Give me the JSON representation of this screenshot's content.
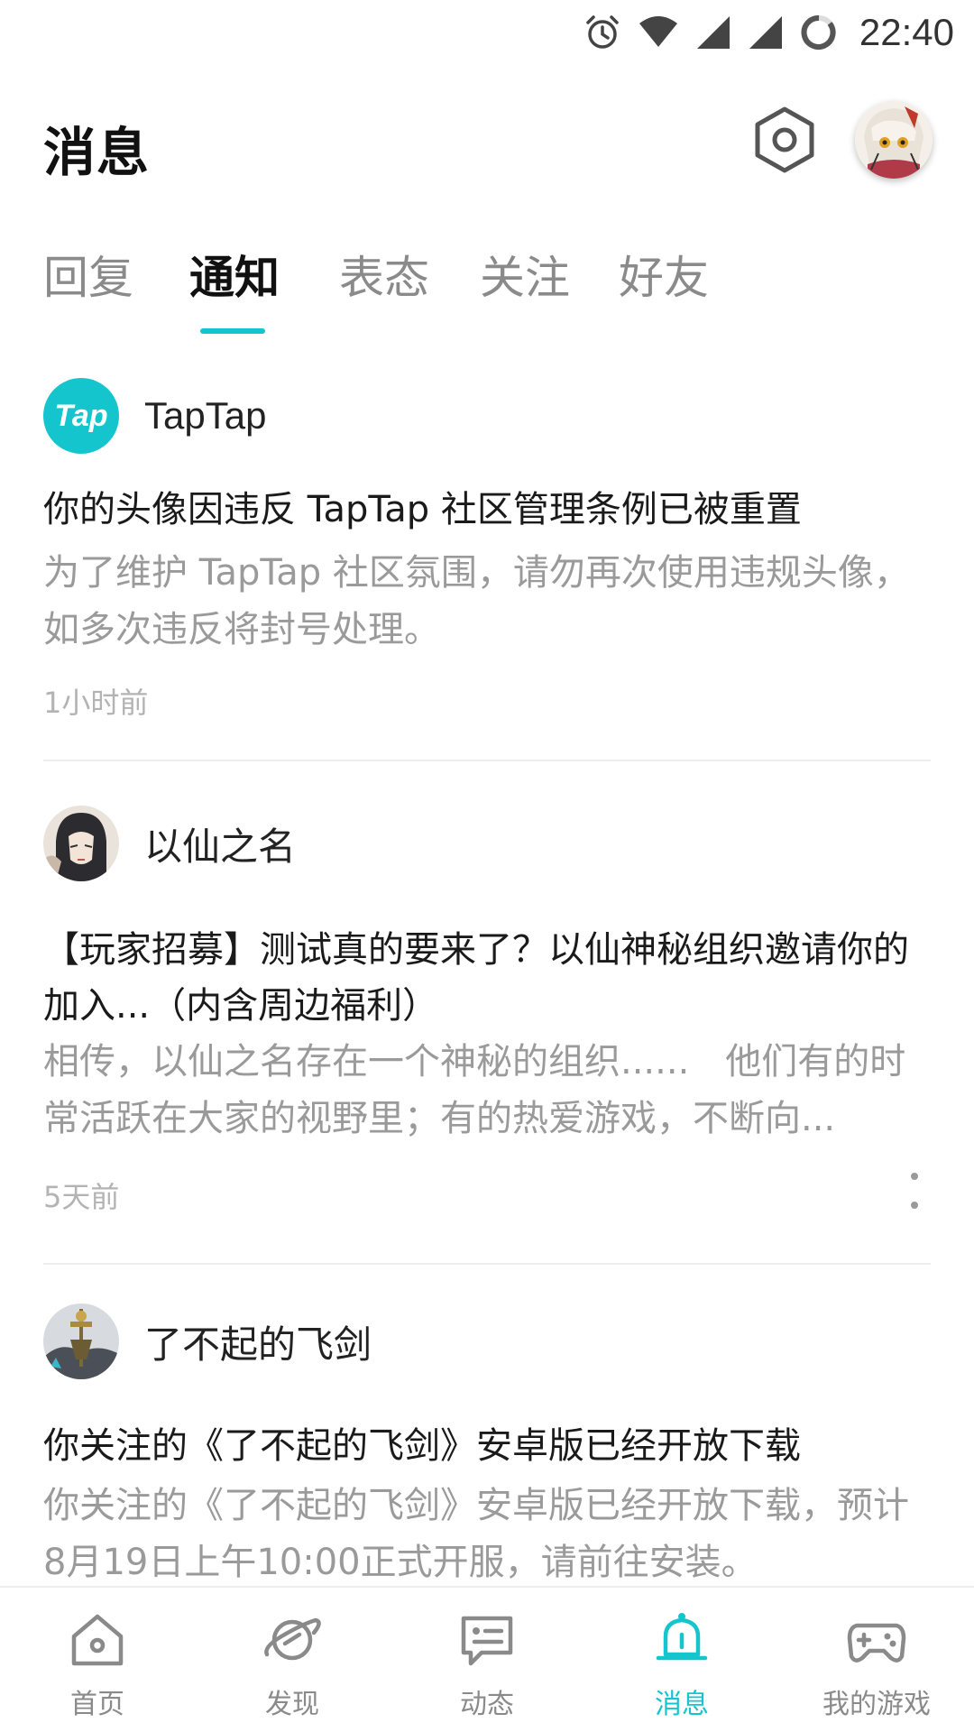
{
  "status_bar": {
    "time": "22:40"
  },
  "header": {
    "title": "消息"
  },
  "tabs": [
    {
      "label": "回复",
      "active": false
    },
    {
      "label": "通知",
      "active": true
    },
    {
      "label": "表态",
      "active": false
    },
    {
      "label": "关注",
      "active": false
    },
    {
      "label": "好友",
      "active": false
    }
  ],
  "notifications": [
    {
      "sender": "TapTap",
      "logo_text": "Tap",
      "title": "你的头像因违反 TapTap 社区管理条例已被重置",
      "body": "为了维护 TapTap 社区氛围，请勿再次使用违规头像，如多次违反将封号处理。",
      "time": "1小时前"
    },
    {
      "sender": "以仙之名",
      "title": "【玩家招募】测试真的要来了？以仙神秘组织邀请你的加入...（内含周边福利）",
      "body": "相传，以仙之名存在一个神秘的组织......　他们有的时常活跃在大家的视野里；有的热爱游戏，不断向...",
      "time": "5天前"
    },
    {
      "sender": "了不起的飞剑",
      "title": "你关注的《了不起的飞剑》安卓版已经开放下载",
      "body": "你关注的《了不起的飞剑》安卓版已经开放下载，预计8月19日上午10:00正式开服，请前往安装。",
      "time": ""
    }
  ],
  "bottom_nav": [
    {
      "label": "首页",
      "icon": "home-icon",
      "active": false
    },
    {
      "label": "发现",
      "icon": "planet-icon",
      "active": false
    },
    {
      "label": "动态",
      "icon": "feed-icon",
      "active": false
    },
    {
      "label": "消息",
      "icon": "bell-icon",
      "active": true
    },
    {
      "label": "我的游戏",
      "icon": "gamepad-icon",
      "active": false
    }
  ],
  "colors": {
    "accent": "#15c5ce",
    "text_primary": "#1a1a1a",
    "text_secondary": "#9a9a9a",
    "text_muted": "#b3b3b3",
    "divider": "#ececec"
  }
}
